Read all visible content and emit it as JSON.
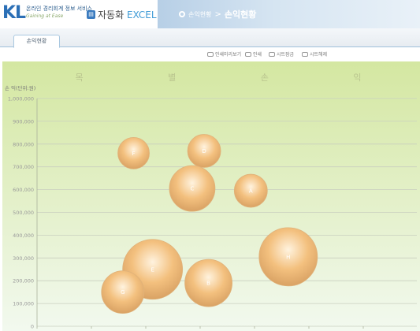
{
  "header": {
    "logo_letters": "KL",
    "logo_line1": "온라인 경리회계 정보 서비스",
    "logo_line2": "Gaining at Ease",
    "product_icon": "chart-badge-icon",
    "product_name_ko": "자동화",
    "product_name_en": "EXCEL",
    "breadcrumb_parent": "손익현황",
    "breadcrumb_sep": ">",
    "breadcrumb_current": "손익현황"
  },
  "tabs": [
    {
      "label": "손익현황",
      "active": true
    }
  ],
  "toolbar": [
    {
      "label": "인쇄미리보기",
      "icon": "print-preview-icon"
    },
    {
      "label": "인쇄",
      "icon": "print-icon"
    },
    {
      "label": "시트잠금",
      "icon": "lock-icon"
    },
    {
      "label": "시트해제",
      "icon": "unlock-icon"
    }
  ],
  "colors": {
    "plot_top": "#d4e7a1",
    "plot_bottom": "#f2f9ef",
    "bubble_fill": "#f3c07e",
    "bubble_highlight": "#fff3df",
    "tick_text": "#9a9a9a",
    "header_blue": "#2b6fb6"
  },
  "chart_data": {
    "type": "scatter",
    "bubble": true,
    "title": "품 목 별 손 익 현",
    "ylabel": "손 익(단위:원)",
    "ylim": [
      0,
      1000000
    ],
    "y_ticks": [
      "1,000,000",
      "900,000",
      "800,000",
      "700,000",
      "600,000",
      "500,000",
      "400,000",
      "300,000",
      "200,000",
      "100,000",
      "0"
    ],
    "grid": true,
    "xlim": [
      0,
      7
    ],
    "points": [
      {
        "label": "F",
        "x": 1.78,
        "y": 760000,
        "size": 20
      },
      {
        "label": "D",
        "x": 3.08,
        "y": 770000,
        "size": 21
      },
      {
        "label": "C",
        "x": 2.86,
        "y": 605000,
        "size": 29
      },
      {
        "label": "A",
        "x": 3.94,
        "y": 595000,
        "size": 21
      },
      {
        "label": "E",
        "x": 2.13,
        "y": 250000,
        "size": 38
      },
      {
        "label": "G",
        "x": 1.58,
        "y": 150000,
        "size": 27
      },
      {
        "label": "B",
        "x": 3.16,
        "y": 190000,
        "size": 30
      },
      {
        "label": "H",
        "x": 4.63,
        "y": 305000,
        "size": 37
      }
    ]
  }
}
